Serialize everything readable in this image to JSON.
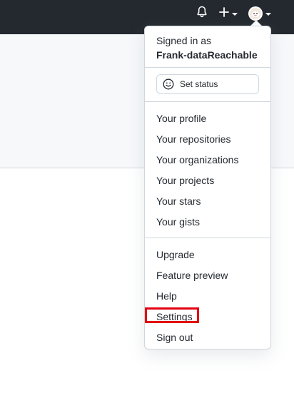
{
  "header": {
    "icons": {
      "notifications": "bell-icon",
      "create": "plus-icon",
      "avatar": "avatar-icon"
    }
  },
  "dropdown": {
    "signed_in_prefix": "Signed in as",
    "username": "Frank-dataReachable",
    "status_button": "Set status",
    "section1": [
      "Your profile",
      "Your repositories",
      "Your organizations",
      "Your projects",
      "Your stars",
      "Your gists"
    ],
    "section2": [
      "Upgrade",
      "Feature preview",
      "Help",
      "Settings",
      "Sign out"
    ],
    "highlighted_item": "Settings",
    "highlight_color": "#e3000f"
  },
  "colors": {
    "topbar": "#24292f",
    "subheader": "#f6f8fa",
    "border": "#d0d7de",
    "text": "#24292f"
  }
}
